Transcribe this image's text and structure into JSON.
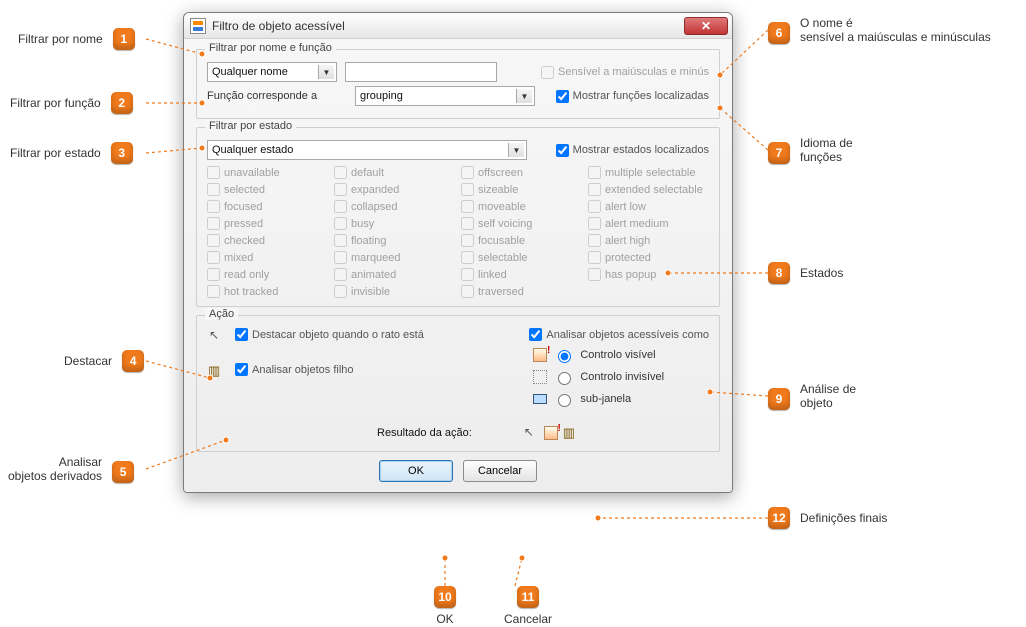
{
  "title": "Filtro de objeto acessível",
  "group_name_func": {
    "title": "Filtrar por nome e função",
    "any_name": "Qualquer nome",
    "case_sensitive": "Sensível a maiúsculas e minús",
    "func_label": "Função corresponde a",
    "func_value": "grouping",
    "show_localized_func": "Mostrar funções localizadas"
  },
  "group_state": {
    "title": "Filtrar por estado",
    "any_state": "Qualquer estado",
    "show_localized_state": "Mostrar estados localizados",
    "states_col1": [
      "unavailable",
      "selected",
      "focused",
      "pressed",
      "checked",
      "mixed",
      "read only",
      "hot tracked"
    ],
    "states_col2": [
      "default",
      "expanded",
      "collapsed",
      "busy",
      "floating",
      "marqueed",
      "animated",
      "invisible"
    ],
    "states_col3": [
      "offscreen",
      "sizeable",
      "moveable",
      "self voicing",
      "focusable",
      "selectable",
      "linked",
      "traversed"
    ],
    "states_col4": [
      "multiple selectable",
      "extended selectable",
      "alert low",
      "alert medium",
      "alert high",
      "protected",
      "has popup"
    ]
  },
  "group_action": {
    "title": "Ação",
    "highlight": "Destacar objeto quando o rato está",
    "analyze_as": "Analisar objetos acessíveis como",
    "analyze_children": "Analisar objetos filho",
    "visible_control": "Controlo visível",
    "invisible_control": "Controlo invisível",
    "sub_window": "sub-janela",
    "result_label": "Resultado da ação:"
  },
  "buttons": {
    "ok": "OK",
    "cancel": "Cancelar"
  },
  "callouts": {
    "c1": "Filtrar por nome",
    "c2": "Filtrar por função",
    "c3": "Filtrar por estado",
    "c4": "Destacar",
    "c5_a": "Analisar",
    "c5_b": "objetos derivados",
    "c6_a": "O nome é",
    "c6_b": "sensível a maiúsculas e minúsculas",
    "c7_a": "Idioma de",
    "c7_b": "funções",
    "c8": "Estados",
    "c9_a": "Análise de",
    "c9_b": "objeto",
    "c10": "OK",
    "c11": "Cancelar",
    "c12": "Definições finais"
  }
}
